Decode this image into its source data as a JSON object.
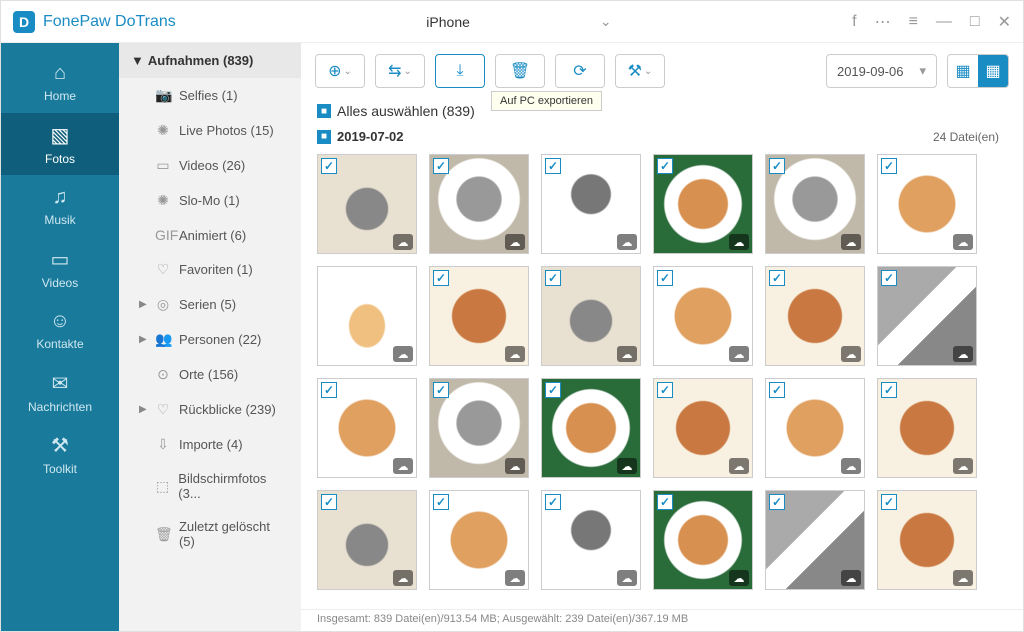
{
  "app": {
    "title": "FonePaw DoTrans"
  },
  "device": {
    "name": "iPhone"
  },
  "nav": [
    {
      "label": "Home",
      "icon": "⌂"
    },
    {
      "label": "Fotos",
      "icon": "▧"
    },
    {
      "label": "Musik",
      "icon": "♫"
    },
    {
      "label": "Videos",
      "icon": "▭"
    },
    {
      "label": "Kontakte",
      "icon": "☺"
    },
    {
      "label": "Nachrichten",
      "icon": "✉"
    },
    {
      "label": "Toolkit",
      "icon": "⚒"
    }
  ],
  "sub": {
    "header": "Aufnahmen (839)",
    "items": [
      {
        "icon": "📷",
        "label": "Selfies (1)",
        "arrow": ""
      },
      {
        "icon": "✺",
        "label": "Live Photos (15)",
        "arrow": ""
      },
      {
        "icon": "▭",
        "label": "Videos (26)",
        "arrow": ""
      },
      {
        "icon": "✺",
        "label": "Slo-Mo (1)",
        "arrow": ""
      },
      {
        "icon": "GIF",
        "label": "Animiert (6)",
        "arrow": ""
      },
      {
        "icon": "♡",
        "label": "Favoriten (1)",
        "arrow": ""
      },
      {
        "icon": "◎",
        "label": "Serien (5)",
        "arrow": "▶"
      },
      {
        "icon": "👥",
        "label": "Personen (22)",
        "arrow": "▶"
      },
      {
        "icon": "⊙",
        "label": "Orte (156)",
        "arrow": ""
      },
      {
        "icon": "♡",
        "label": "Rückblicke (239)",
        "arrow": "▶"
      },
      {
        "icon": "⇩",
        "label": "Importe (4)",
        "arrow": ""
      },
      {
        "icon": "⬚",
        "label": "Bildschirmfotos (3...",
        "arrow": ""
      },
      {
        "icon": "🗑",
        "label": "Zuletzt gelöscht (5)",
        "arrow": ""
      }
    ]
  },
  "toolbar": {
    "tooltip": "Auf PC exportieren",
    "date": "2019-09-06"
  },
  "selectall": {
    "label": "Alles auswählen (839)"
  },
  "group": {
    "date": "2019-07-02",
    "count": "24 Datei(en)"
  },
  "status": "Insgesamt: 839 Datei(en)/913.54 MB; Ausgewählt: 239 Datei(en)/367.19 MB",
  "thumbs": [
    [
      "cat1",
      "cat2",
      "cat3",
      "dog1",
      "cat2",
      "dog2"
    ],
    [
      "sticker",
      "dog3",
      "cat1",
      "dog2",
      "dog3",
      "mix1"
    ],
    [
      "dog2",
      "cat2",
      "dog1",
      "dog3",
      "dog2",
      "dog3"
    ],
    [
      "cat1",
      "dog2",
      "cat3",
      "dog1",
      "mix1",
      "dog3"
    ]
  ]
}
